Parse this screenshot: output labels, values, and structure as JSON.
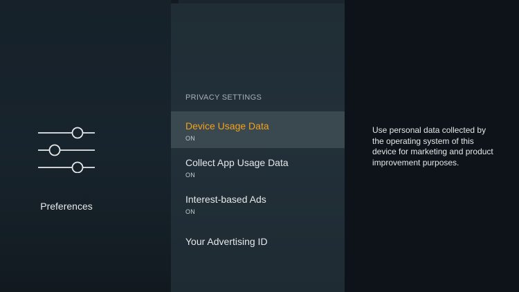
{
  "sidebar": {
    "icon": "sliders-icon",
    "label": "Preferences"
  },
  "menu": {
    "section_header": "PRIVACY SETTINGS",
    "items": [
      {
        "title": "Device Usage Data",
        "status": "ON",
        "selected": true
      },
      {
        "title": "Collect App Usage Data",
        "status": "ON",
        "selected": false
      },
      {
        "title": "Interest-based Ads",
        "status": "ON",
        "selected": false
      },
      {
        "title": "Your Advertising ID",
        "status": "",
        "selected": false
      }
    ]
  },
  "detail": {
    "description": "Use personal data collected by the operating system of this device for marketing and product improvement purposes."
  },
  "colors": {
    "accent": "#f4a31d",
    "background": "#131b21",
    "menu_panel": "#223039",
    "selected_row": "#3a4850"
  }
}
